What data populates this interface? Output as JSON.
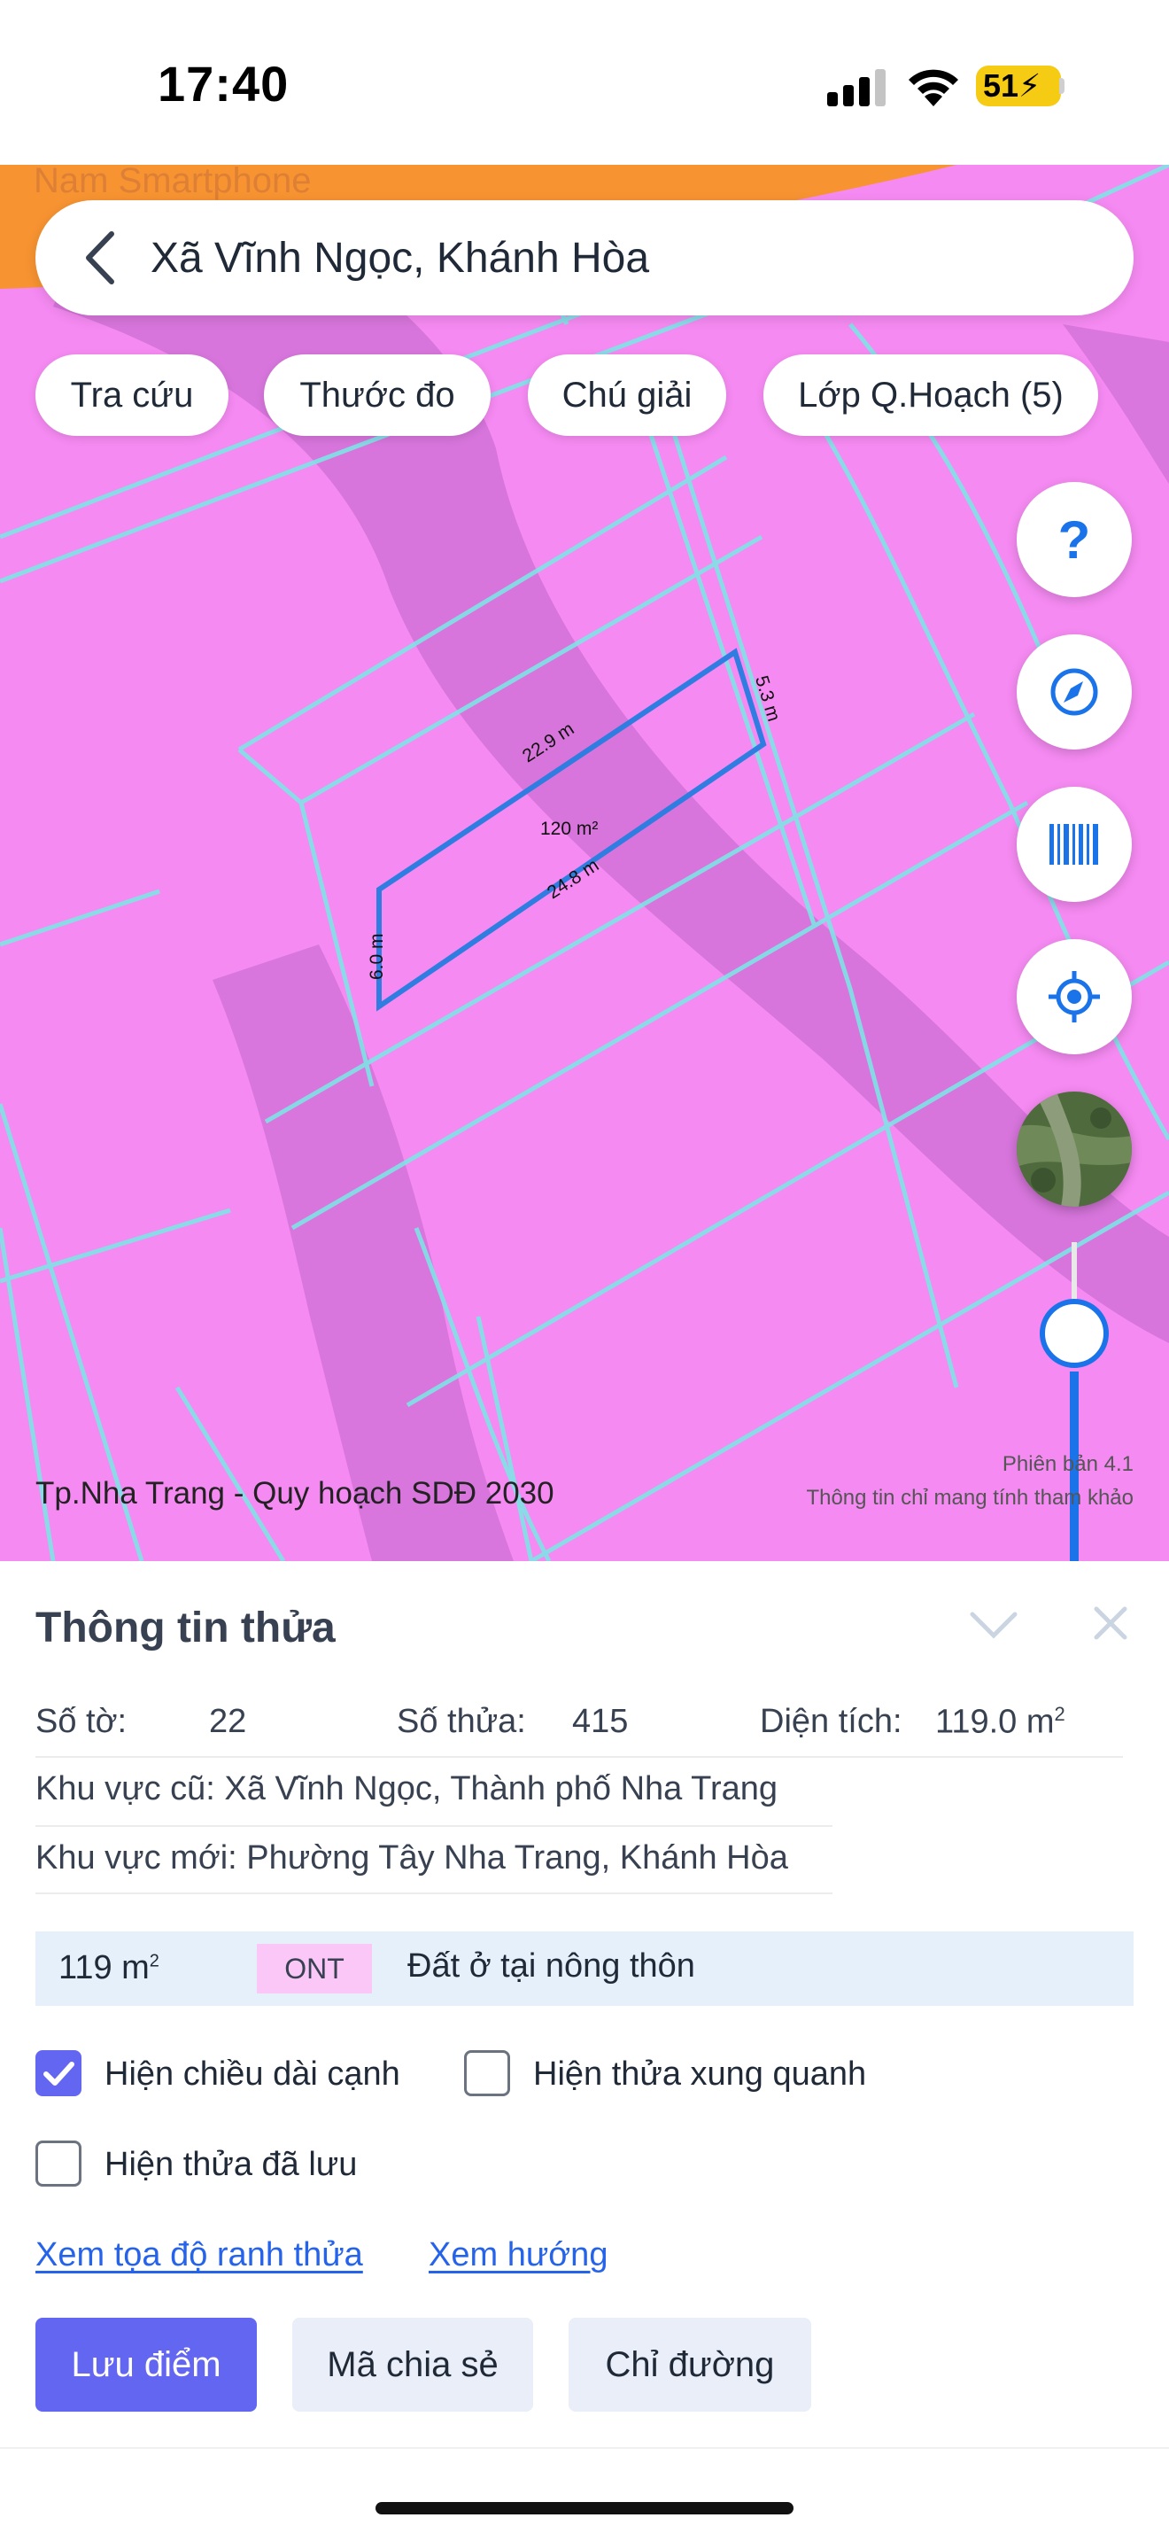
{
  "status_bar": {
    "time": "17:40",
    "battery": "51",
    "icons": [
      "cellular-signal-icon",
      "wifi-icon",
      "battery-charging-icon"
    ]
  },
  "map": {
    "watermark": "Nam Smartphone",
    "search_text": "Xã Vĩnh Ngọc, Khánh Hòa",
    "chips": [
      "Tra cứu",
      "Thước đo",
      "Chú giải",
      "Lớp Q.Hoạch (5)"
    ],
    "parcel": {
      "edge_top": "22.9 m",
      "edge_right": "5.3 m",
      "edge_bottom": "24.8 m",
      "edge_left": "6.0 m",
      "area": "120 m²"
    },
    "caption": "Tp.Nha Trang - Quy hoạch SDĐ 2030",
    "version": "Phiên bản 4.1",
    "disclaimer": "Thông tin chỉ mang tính tham khảo",
    "colors": {
      "land": "#f58af2",
      "boundary": "#7fe3e6",
      "parcel_outline": "#2f7de1"
    },
    "fab_icons": [
      "help-icon",
      "compass-icon",
      "barcode-icon",
      "locate-icon",
      "satellite-icon"
    ]
  },
  "sheet": {
    "title": "Thông tin thửa",
    "so_to_label": "Số tờ:",
    "so_to_value": "22",
    "so_thua_label": "Số thửa:",
    "so_thua_value": "415",
    "dien_tich_label": "Diện tích:",
    "dien_tich_value": "119.0 m",
    "dien_tich_sup": "2",
    "khu_vuc_cu": "Khu vực cũ: Xã Vĩnh Ngọc, Thành phố Nha Trang",
    "khu_vuc_moi": "Khu vực mới: Phường Tây Nha Trang, Khánh Hòa",
    "land": {
      "area": "119 m",
      "area_sup": "2",
      "code": "ONT",
      "desc": "Đất ở tại nông thôn"
    },
    "checkboxes": [
      {
        "label": "Hiện chiều dài cạnh",
        "checked": true
      },
      {
        "label": "Hiện thửa xung quanh",
        "checked": false
      },
      {
        "label": "Hiện thửa đã lưu",
        "checked": false
      }
    ],
    "links": [
      "Xem tọa độ ranh thửa",
      "Xem hướng"
    ],
    "buttons": [
      "Lưu điểm",
      "Mã chia sẻ",
      "Chỉ đường"
    ],
    "accent": "#6366f1"
  }
}
